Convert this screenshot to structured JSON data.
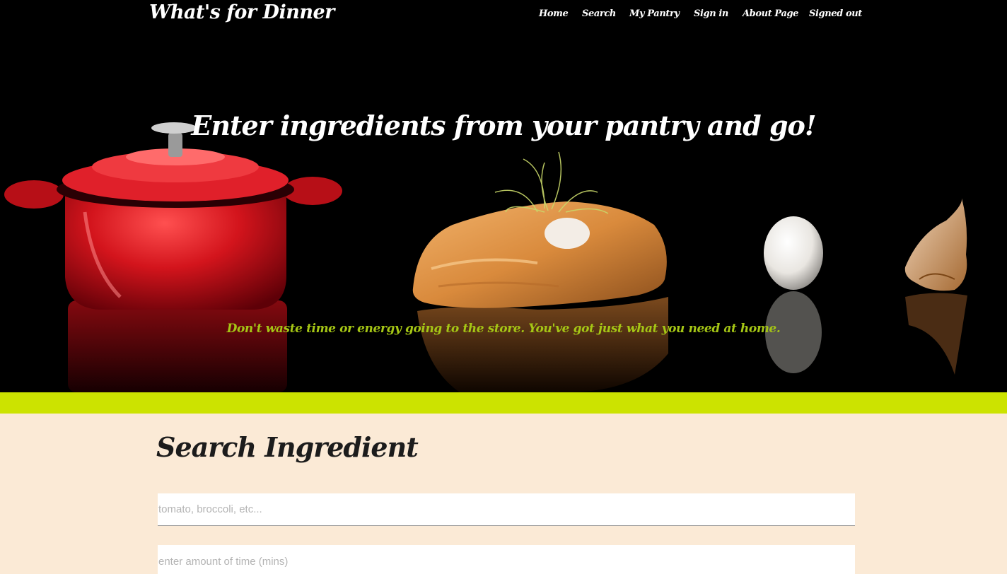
{
  "header": {
    "brand": "What's for Dinner",
    "nav": [
      {
        "label": "Home"
      },
      {
        "label": "Search"
      },
      {
        "label": "My Pantry"
      },
      {
        "label": "Sign in"
      },
      {
        "label": "About Page"
      },
      {
        "label": "Signed out"
      }
    ]
  },
  "hero": {
    "title": "Enter ingredients from your pantry and go!",
    "subtitle": "Don't waste time or energy going to the store. You've got just what you need at home."
  },
  "search": {
    "title": "Search Ingredient",
    "ingredient_placeholder": "tomato, broccoli, etc...",
    "time_placeholder": "enter amount of time (mins)"
  },
  "colors": {
    "hero_bg": "#000000",
    "accent": "#cce300",
    "subtitle": "#a5c615",
    "section_bg": "#fbead6",
    "pot_red": "#d3141c"
  },
  "icons": {
    "hero_image": "food-photo-pot-fish-egg-garlic"
  }
}
